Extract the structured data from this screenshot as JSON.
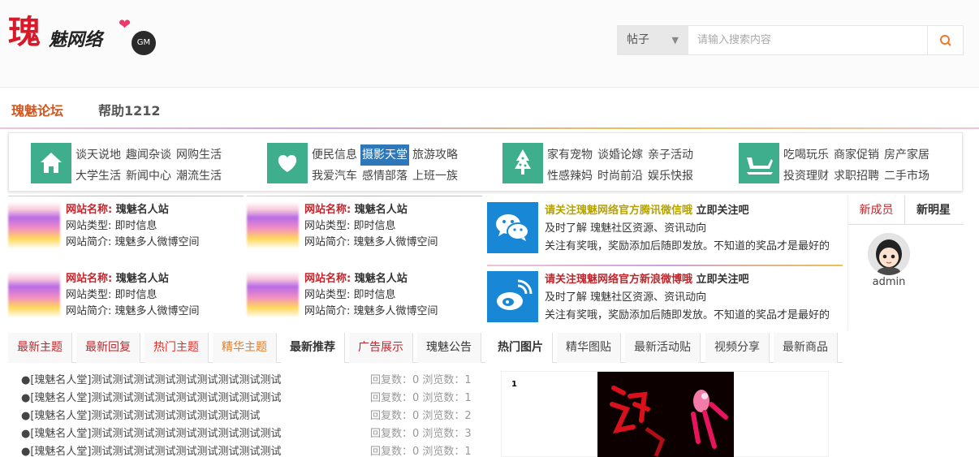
{
  "logo": {
    "big": "瑰",
    "small": "魅网络",
    "badge": "GM"
  },
  "search": {
    "category": "帖子",
    "placeholder": "请输入搜索内容"
  },
  "nav": {
    "items": [
      "瑰魅论坛",
      "帮助1212"
    ]
  },
  "categories": [
    {
      "icon": "home-icon",
      "links": [
        "谈天说地",
        "趣闻杂谈",
        "网购生活",
        "大学生活",
        "新闻中心",
        "潮流生活"
      ]
    },
    {
      "icon": "heart-icon",
      "links": [
        "便民信息",
        "摄影天堂",
        "旅游攻略",
        "我爱汽车",
        "感情部落",
        "上班一族"
      ],
      "highlighted": 1
    },
    {
      "icon": "tree-icon",
      "links": [
        "家有宠物",
        "谈婚论嫁",
        "亲子活动",
        "性感辣妈",
        "时尚前沿",
        "娱乐快报"
      ]
    },
    {
      "icon": "sleigh-icon",
      "links": [
        "吃喝玩乐",
        "商家促销",
        "房产家居",
        "投资理财",
        "求职招聘",
        "二手市场"
      ]
    }
  ],
  "sites": [
    {
      "name_label": "网站名称:",
      "name": "瑰魅名人站",
      "type": "网站类型: 即时信息",
      "desc": "网站简介: 瑰魅多人微博空间"
    },
    {
      "name_label": "网站名称:",
      "name": "瑰魅名人站",
      "type": "网站类型: 即时信息",
      "desc": "网站简介: 瑰魅多人微博空间"
    },
    {
      "name_label": "网站名称:",
      "name": "瑰魅名人站",
      "type": "网站类型: 即时信息",
      "desc": "网站简介: 瑰魅多人微博空间"
    },
    {
      "name_label": "网站名称:",
      "name": "瑰魅名人站",
      "type": "网站类型: 即时信息",
      "desc": "网站简介: 瑰魅多人微博空间"
    }
  ],
  "follow": [
    {
      "icon": "wechat-icon",
      "title": "请关注瑰魅网络官方腾讯微信哦",
      "action": "立即关注吧",
      "line1": "及时了解 瑰魅社区资源、资讯动向",
      "line2": "关注有奖哦，奖励添加后随即发放。不知道的奖品才是最好的",
      "accent": "#b5a300"
    },
    {
      "icon": "weibo-icon",
      "title": "请关注瑰魅网络官方新浪微博哦",
      "action": "立即关注吧",
      "line1": "及时了解 瑰魅社区资源、资讯动向",
      "line2": "关注有奖哦，奖励添加后随即发放。不知道的奖品才是最好的",
      "accent": "#c0262b"
    }
  ],
  "members": {
    "tabs": [
      "新成员",
      "新明星"
    ],
    "user": "admin"
  },
  "left_tabs": [
    {
      "label": "最新主题",
      "color": "#c0262b"
    },
    {
      "label": "最新回复",
      "color": "#c0262b"
    },
    {
      "label": "热门主题",
      "color": "#e0312a"
    },
    {
      "label": "精华主题",
      "color": "#e07d2a"
    },
    {
      "label": "最新推荐",
      "color": "#333333"
    },
    {
      "label": "广告展示",
      "color": "#c0262b"
    },
    {
      "label": "瑰魅公告",
      "color": "#444444"
    }
  ],
  "right_tabs": [
    "热门图片",
    "精华图贴",
    "最新活动贴",
    "视频分享",
    "最新商品"
  ],
  "threads": [
    {
      "title": "●[瑰魅名人堂]测试测试测试测试测试测试测试测试测试",
      "stats": "回复数：0 浏览数：1"
    },
    {
      "title": "●[瑰魅名人堂]测试测试测试测试测试测试测试测试测试",
      "stats": "回复数：0 浏览数：1"
    },
    {
      "title": "●[瑰魅名人堂]测试测试测试测试测试测试测试测试",
      "stats": "回复数：0 浏览数：2"
    },
    {
      "title": "●[瑰魅名人堂]测试测试测试测试测试测试测试测试测试",
      "stats": "回复数：0 浏览数：3"
    },
    {
      "title": "●[瑰魅名人堂]测试测试测试测试测试测试测试测试测试",
      "stats": "回复数：0 浏览数：1"
    }
  ],
  "photo": {
    "index": "1"
  }
}
